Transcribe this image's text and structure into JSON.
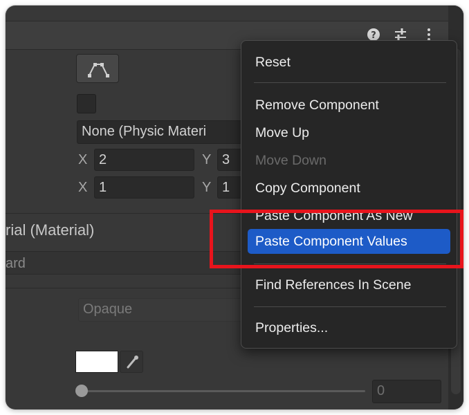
{
  "header": {
    "help_icon": "question-circle-icon",
    "preset_icon": "sliders-icon",
    "more_icon": "vertical-ellipsis-icon"
  },
  "collider": {
    "edit_icon": "edit-collider-icon",
    "material_value": "None (Physic Materi",
    "offset": {
      "x_label": "X",
      "x_value": "2",
      "y_label": "Y",
      "y_value": "3"
    },
    "size": {
      "x_label": "X",
      "x_value": "1",
      "y_label": "Y",
      "y_value": "1"
    }
  },
  "material": {
    "title": "rial (Material)",
    "shader": "ard"
  },
  "material_props": {
    "rendering_mode": "Opaque",
    "color_swatch": "#ffffff",
    "eyedropper_icon": "eyedropper-icon",
    "slider_value": "0",
    "slider_level": 0
  },
  "context_menu": {
    "reset": "Reset",
    "remove_component": "Remove Component",
    "move_up": "Move Up",
    "move_down": "Move Down",
    "copy_component": "Copy Component",
    "paste_as_new": "Paste Component As New",
    "paste_values": "Paste Component Values",
    "find_references": "Find References In Scene",
    "properties": "Properties..."
  },
  "colors": {
    "highlight": "#1d5bc7",
    "annotation": "#e8141c"
  }
}
